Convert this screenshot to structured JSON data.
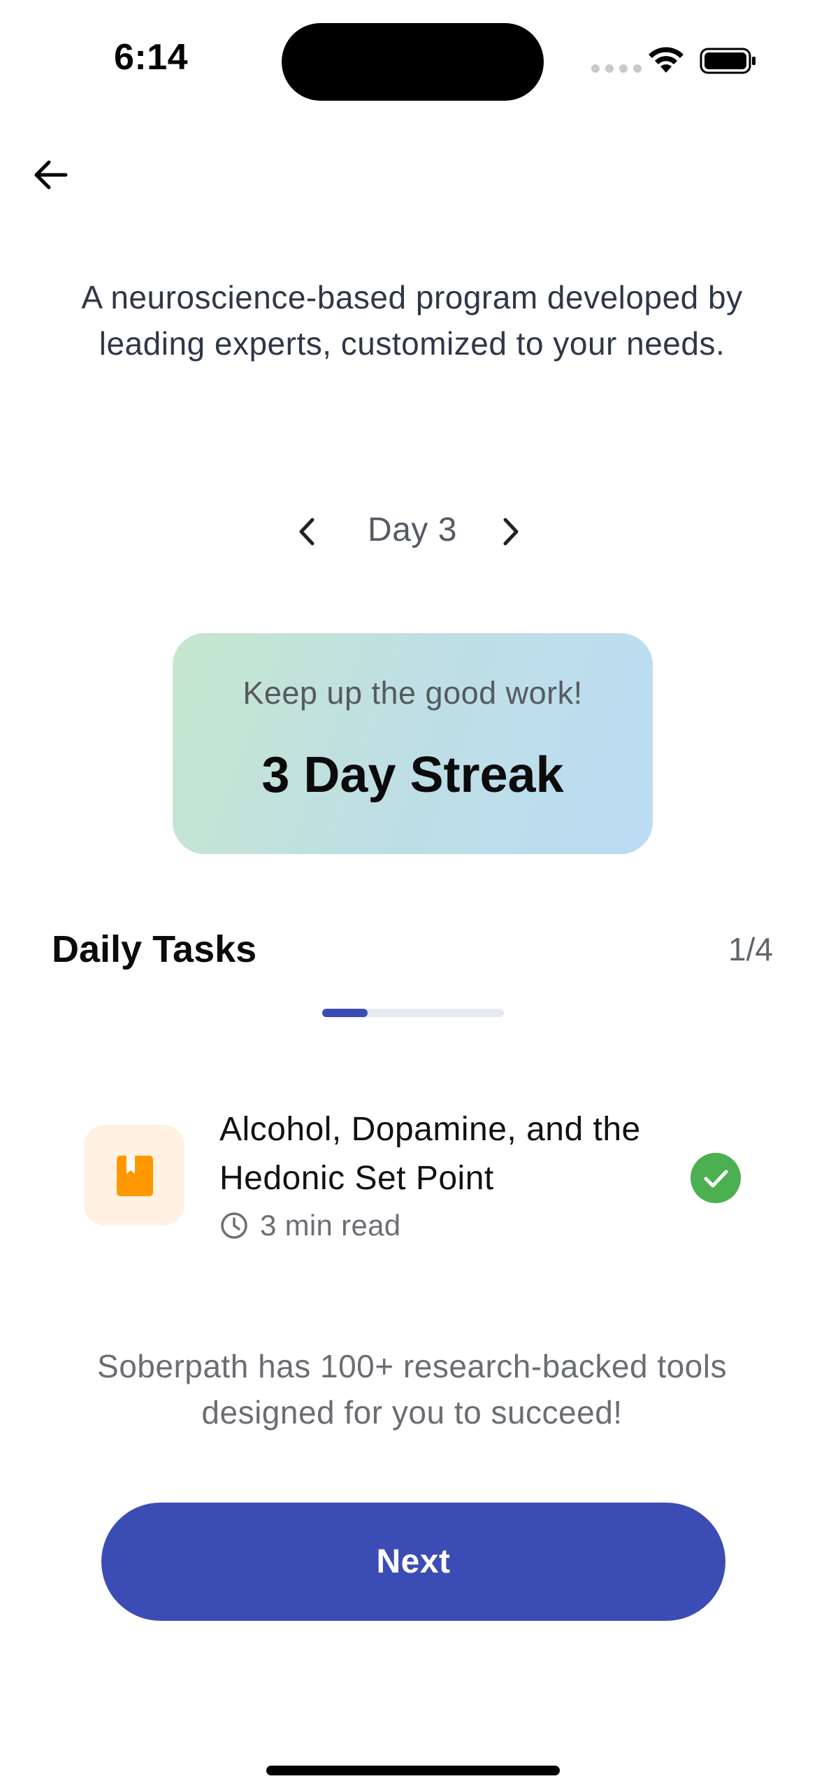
{
  "status_bar": {
    "time": "6:14",
    "icons": [
      "signal-icon",
      "wifi-icon",
      "battery-icon"
    ]
  },
  "nav": {
    "back_icon": "arrow-left-icon"
  },
  "intro_text": "A neuroscience-based program developed by leading experts, customized to your needs.",
  "day_selector": {
    "label": "Day 3",
    "prev_icon": "chevron-left-icon",
    "next_icon": "chevron-right-icon"
  },
  "streak_card": {
    "subtitle": "Keep up the good work!",
    "title": "3 Day Streak",
    "gradient_colors": [
      "#c6e7cd",
      "#bbdcf4"
    ]
  },
  "daily_tasks": {
    "title": "Daily Tasks",
    "count": "1/4",
    "progress_fraction": 0.25,
    "items": [
      {
        "title": "Alcohol, Dopamine, and the Hedonic Set Point",
        "read_time": "3 min read",
        "icon": "book-icon",
        "completed": true
      }
    ]
  },
  "footer_text": "Soberpath has 100+ research-backed tools designed for you to succeed!",
  "next_button": {
    "label": "Next"
  },
  "colors": {
    "primary": "#3b4db5",
    "success": "#4caf50",
    "task_icon_bg": "#fff2e3",
    "task_icon": "#ff9800"
  }
}
